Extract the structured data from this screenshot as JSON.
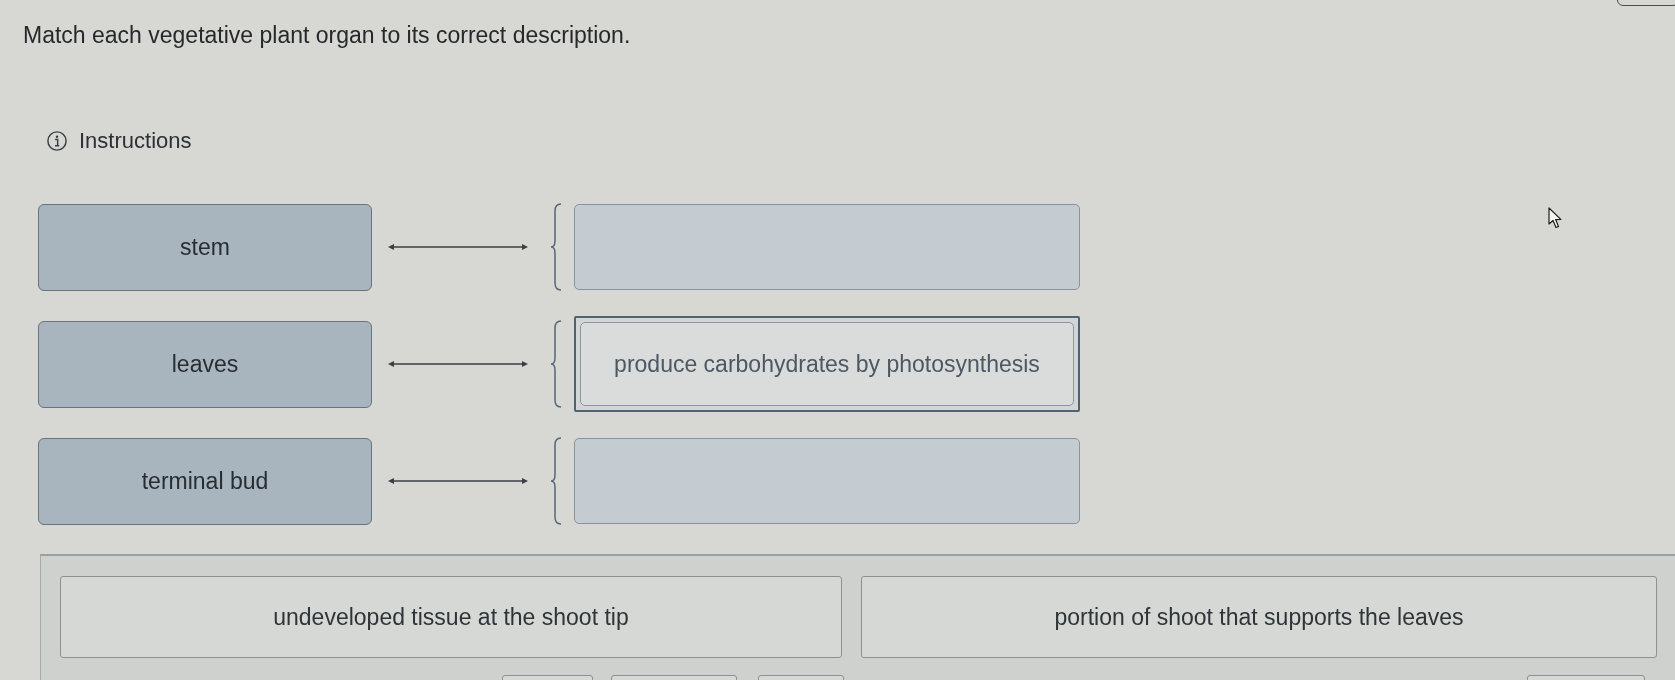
{
  "question": "Match each vegetative plant organ to its correct description.",
  "instructions": {
    "label": "Instructions"
  },
  "pairs": [
    {
      "term": "stem"
    },
    {
      "term": "leaves",
      "answer": "produce carbohydrates by photosynthesis"
    },
    {
      "term": "terminal bud"
    }
  ],
  "answer_bank": [
    {
      "text": "undeveloped tissue at the shoot tip"
    },
    {
      "text": "portion of shoot that supports the leaves"
    }
  ]
}
